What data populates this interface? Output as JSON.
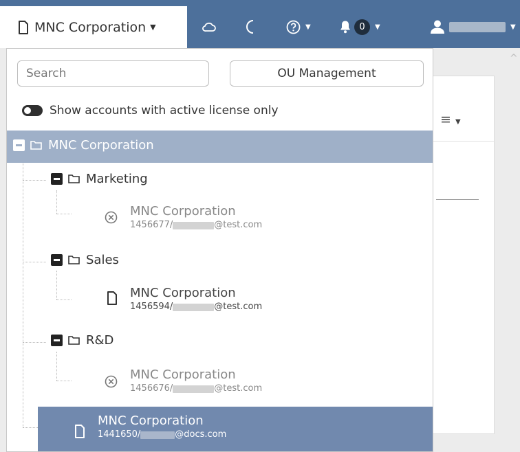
{
  "topbar": {
    "account_label": "MNC Corporation",
    "bell_count": "0",
    "icons": [
      "document-icon",
      "cloud-icon",
      "moon-icon",
      "help-icon",
      "bell-icon",
      "user-icon"
    ]
  },
  "dropdown": {
    "search_placeholder": "Search",
    "ou_button": "OU Management",
    "toggle_label": "Show accounts with active license only",
    "tree": {
      "root": "MNC Corporation",
      "groups": [
        {
          "label": "Marketing",
          "account": {
            "name": "MNC Corporation",
            "id": "1456677/",
            "domain": "@test.com",
            "status": "inactive"
          }
        },
        {
          "label": "Sales",
          "account": {
            "name": "MNC Corporation",
            "id": "1456594/",
            "domain": "@test.com",
            "status": "active"
          }
        },
        {
          "label": "R&D",
          "account": {
            "name": "MNC Corporation",
            "id": "1456676/",
            "domain": "@test.com",
            "status": "inactive"
          }
        }
      ],
      "root_account": {
        "name": "MNC Corporation",
        "id": "1441650/",
        "domain": "@docs.com",
        "status": "selected"
      }
    }
  },
  "colors": {
    "nav": "#4d709b",
    "root_row": "#9fb0c8",
    "selected_row": "#7189ae"
  }
}
